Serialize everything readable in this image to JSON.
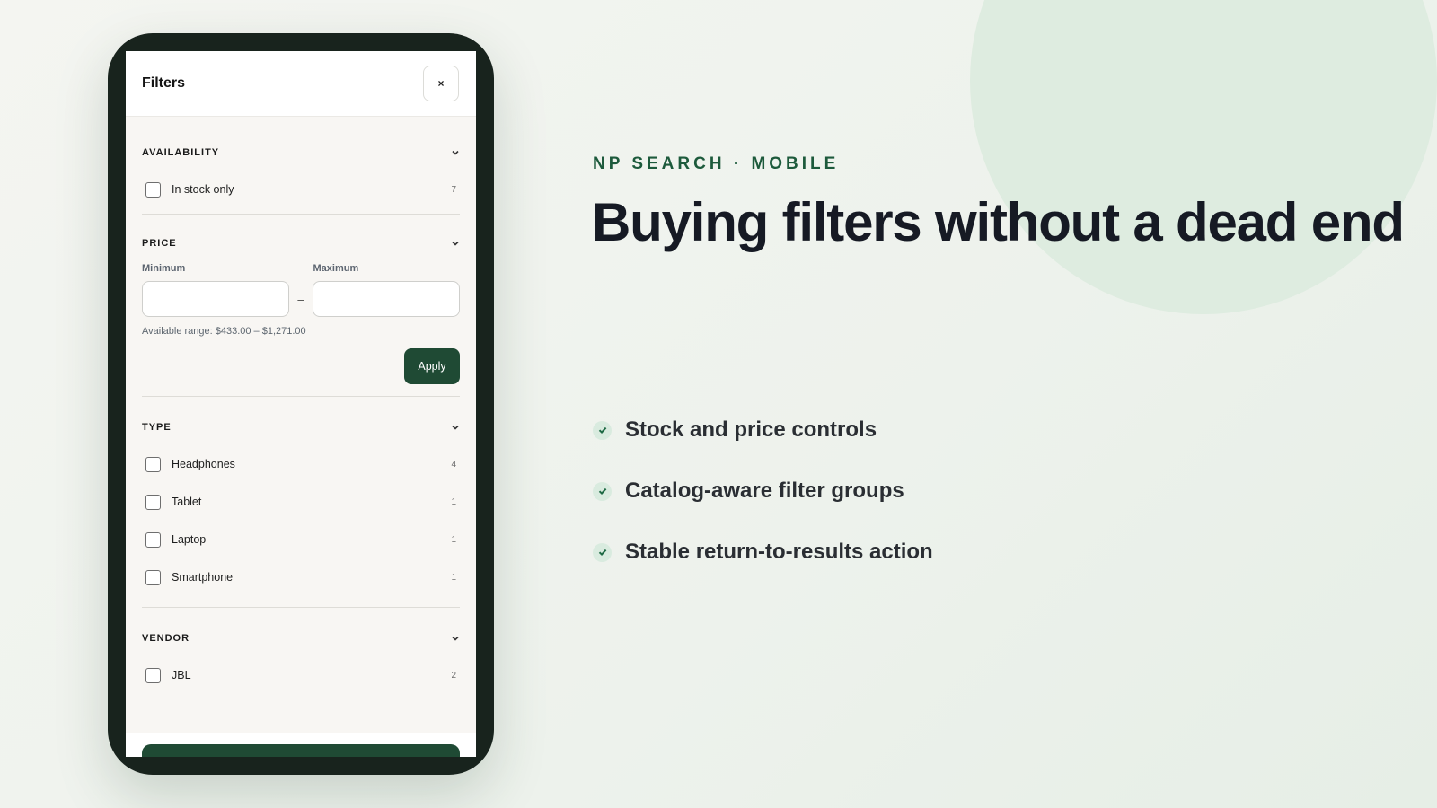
{
  "filters_sheet": {
    "title": "Filters",
    "close_label": "×",
    "availability": {
      "title": "AVAILABILITY",
      "options": [
        {
          "label": "In stock only",
          "count": "7"
        }
      ]
    },
    "price": {
      "title": "PRICE",
      "min_label": "Minimum",
      "max_label": "Maximum",
      "min_value": "",
      "max_value": "",
      "dash": "–",
      "range_note": "Available range: $433.00 – $1,271.00",
      "apply_label": "Apply"
    },
    "type": {
      "title": "TYPE",
      "options": [
        {
          "label": "Headphones",
          "count": "4"
        },
        {
          "label": "Tablet",
          "count": "1"
        },
        {
          "label": "Laptop",
          "count": "1"
        },
        {
          "label": "Smartphone",
          "count": "1"
        }
      ]
    },
    "vendor": {
      "title": "VENDOR",
      "options": [
        {
          "label": "JBL",
          "count": "2"
        }
      ]
    }
  },
  "promo": {
    "eyebrow": "NP SEARCH · MOBILE",
    "headline": "Buying filters without a dead end",
    "features": [
      "Stock and price controls",
      "Catalog-aware filter groups",
      "Stable return-to-results action"
    ]
  },
  "colors": {
    "brand_green": "#1f4a34",
    "eyebrow_green": "#1d5a3c",
    "phone_frame": "#18231d"
  }
}
